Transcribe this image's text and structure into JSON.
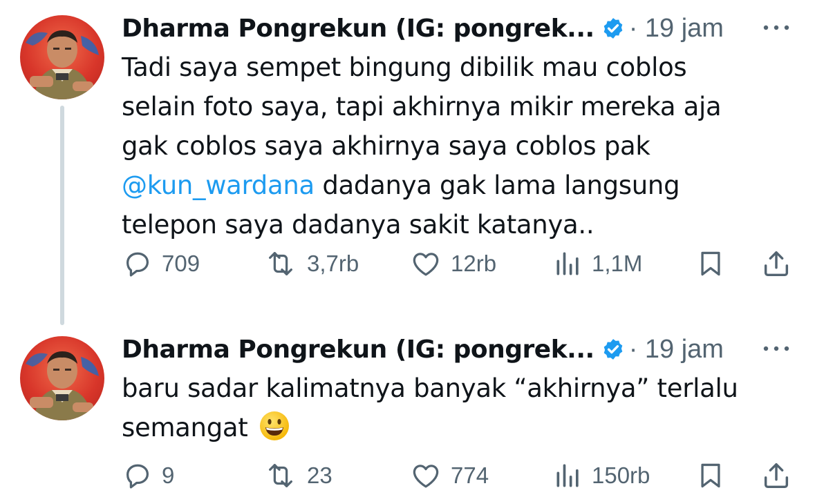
{
  "theme": {
    "text": "#0f1419",
    "muted": "#536471",
    "link": "#1d9bf0",
    "verified": "#1d9bf0",
    "thread_line": "#cfd9de"
  },
  "tweets": [
    {
      "author": "Dharma Pongrekun (IG: pongrek...",
      "time": "· 19 jam",
      "lines": [
        "Tadi saya sempet bingung dibilik mau coblos",
        "selain foto saya, tapi akhirnya mikir mereka aja",
        "gak coblos saya akhirnya saya coblos pak"
      ],
      "mention": "@kun_wardana",
      "mention_rest": " dadanya gak lama langsung",
      "last_line": "telepon saya dadanya sakit katanya..",
      "stats": {
        "replies": "709",
        "reposts": "3,7rb",
        "likes": "12rb",
        "views": "1,1M"
      },
      "icons": {
        "verified": "verified-badge-icon",
        "reply": "reply-icon",
        "repost": "repost-icon",
        "like": "heart-icon",
        "views": "views-chart-icon",
        "bookmark": "bookmark-icon",
        "share": "share-icon",
        "more": "more-dots-icon"
      }
    },
    {
      "author": "Dharma Pongrekun (IG: pongrek...",
      "time": "· 19 jam",
      "lines": [
        "baru sadar kalimatnya banyak “akhirnya” terlalu"
      ],
      "last_line": "semangat",
      "emoji": "grinning-face-emoji",
      "stats": {
        "replies": "9",
        "reposts": "23",
        "likes": "774",
        "views": "150rb"
      }
    }
  ]
}
